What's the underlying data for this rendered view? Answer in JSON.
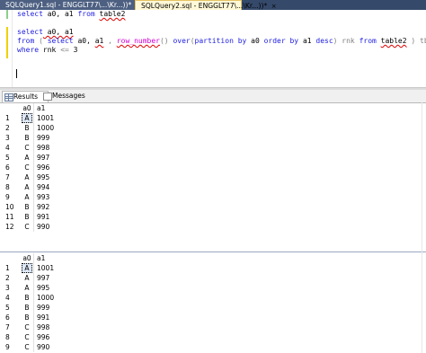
{
  "tabs": [
    {
      "label": "SQLQuery1.sql - ENGGLT77\\...\\Kr...))*",
      "close": "×"
    },
    {
      "label": "SQLQuery2.sql - ENGGLT77\\...\\Kr...))*",
      "close": "×"
    }
  ],
  "editor": {
    "line1": {
      "kw1": "select",
      "cols": " a0, a1 ",
      "kw2": "from",
      "tbl": "table2"
    },
    "line3": {
      "kw1": "select",
      "cols": " a0, a1"
    },
    "line4": {
      "kw1": "from",
      "p1": " ( ",
      "kw2": "select",
      "c1": " a0, ",
      "c2": "a1",
      "c3": " , ",
      "fn1": "row_number",
      "p2": "() ",
      "kw3": "over",
      "p3": "(",
      "kw4": "partition by",
      "c4": " a0 ",
      "kw5": "order by",
      "c5": " a1 ",
      "kw6": "desc",
      "p4": ") rnk ",
      "kw7": "from",
      "tbl": "table2",
      "p5": " ) tbl"
    },
    "line5": {
      "kw1": "where",
      "c1": " rnk ",
      "op": "<=",
      "c2": " 3"
    }
  },
  "results_tabs": {
    "results": "Results",
    "messages": "Messages"
  },
  "grid1": {
    "columns": [
      "a0",
      "a1"
    ],
    "rows": [
      {
        "n": "1",
        "a0": "A",
        "a1": "1001"
      },
      {
        "n": "2",
        "a0": "B",
        "a1": "1000"
      },
      {
        "n": "3",
        "a0": "B",
        "a1": "999"
      },
      {
        "n": "4",
        "a0": "C",
        "a1": "998"
      },
      {
        "n": "5",
        "a0": "A",
        "a1": "997"
      },
      {
        "n": "6",
        "a0": "C",
        "a1": "996"
      },
      {
        "n": "7",
        "a0": "A",
        "a1": "995"
      },
      {
        "n": "8",
        "a0": "A",
        "a1": "994"
      },
      {
        "n": "9",
        "a0": "A",
        "a1": "993"
      },
      {
        "n": "10",
        "a0": "B",
        "a1": "992"
      },
      {
        "n": "11",
        "a0": "B",
        "a1": "991"
      },
      {
        "n": "12",
        "a0": "C",
        "a1": "990"
      }
    ]
  },
  "grid2": {
    "columns": [
      "a0",
      "a1"
    ],
    "rows": [
      {
        "n": "1",
        "a0": "A",
        "a1": "1001"
      },
      {
        "n": "2",
        "a0": "A",
        "a1": "997"
      },
      {
        "n": "3",
        "a0": "A",
        "a1": "995"
      },
      {
        "n": "4",
        "a0": "B",
        "a1": "1000"
      },
      {
        "n": "5",
        "a0": "B",
        "a1": "999"
      },
      {
        "n": "6",
        "a0": "B",
        "a1": "991"
      },
      {
        "n": "7",
        "a0": "C",
        "a1": "998"
      },
      {
        "n": "8",
        "a0": "C",
        "a1": "996"
      },
      {
        "n": "9",
        "a0": "C",
        "a1": "990"
      }
    ]
  }
}
